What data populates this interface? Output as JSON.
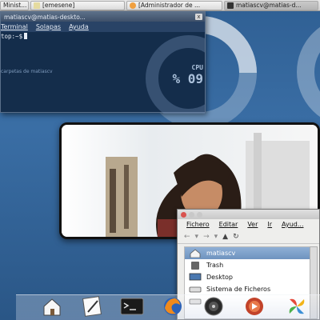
{
  "taskbar": {
    "tasks": [
      {
        "label": "Minist..."
      },
      {
        "label": "[emesene]"
      },
      {
        "label": "[Administrador de ..."
      },
      {
        "label": "matiascv@matias-d..."
      }
    ]
  },
  "wallpaper": {
    "gauge_label": "CPU",
    "gauge_value": "% 09"
  },
  "terminal": {
    "title": "matiascv@matias-deskto...",
    "close": "x",
    "menu": [
      "Terminal",
      "Solapas",
      "Ayuda"
    ],
    "prompt": "top:~$",
    "ghost_text": "carpetas de matiascv"
  },
  "filemanager": {
    "menu": [
      "Fichero",
      "Editar",
      "Ver",
      "Ir",
      "Ayud..."
    ],
    "items": [
      {
        "label": "matiascv",
        "selected": true
      },
      {
        "label": "Trash",
        "selected": false
      },
      {
        "label": "Desktop",
        "selected": false
      },
      {
        "label": "Sistema de Ficheros",
        "selected": false
      },
      {
        "label": "",
        "selected": false
      }
    ]
  },
  "dock": {
    "items": [
      "home",
      "text-editor",
      "terminal",
      "firefox",
      "disc",
      "media-player",
      "pinwheel"
    ]
  },
  "colors": {
    "wallpaper": "#3a6ea5",
    "terminal_bg": "#1f3552",
    "selection": "#7a9cc8"
  }
}
